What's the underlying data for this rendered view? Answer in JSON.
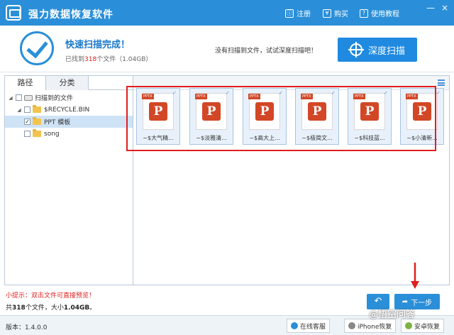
{
  "titlebar": {
    "title": "强力数据恢复软件",
    "register": "注册",
    "buy": "购买",
    "tutorial": "使用教程",
    "register_icon": "ⓘ",
    "buy_icon": "¥",
    "tutorial_icon": "?",
    "minimize": "—",
    "close": "×"
  },
  "header": {
    "status_title": "快速扫描完成！",
    "found_prefix": "已找到",
    "found_count": "318",
    "found_suffix": "个文件（1.04GB）",
    "hint": "没有扫描到文件，试试深度扫描吧！",
    "deep_scan_label": "深度扫描"
  },
  "tabs": {
    "path": "路径",
    "category": "分类"
  },
  "tree": [
    {
      "label": "扫描到的文件",
      "checked": false
    },
    {
      "label": "$RECYCLE.BIN",
      "checked": false
    },
    {
      "label": "PPT 模板",
      "checked": true
    },
    {
      "label": "song",
      "checked": false
    }
  ],
  "files": [
    {
      "name": "~$大气精..."
    },
    {
      "name": "~$淡雅清..."
    },
    {
      "name": "~$高大上..."
    },
    {
      "name": "~$极简文..."
    },
    {
      "name": "~$科技蓝..."
    },
    {
      "name": "~$小清新..."
    }
  ],
  "file_badge": "PPTX",
  "file_glyph": "P",
  "bottom": {
    "tip": "小提示：双击文件可直接预览！",
    "total_prefix": "共",
    "total_count": "318",
    "total_mid": "个文件，大小",
    "total_size": "1.04GB",
    "total_suffix": "。",
    "next_label": "下一步",
    "back_glyph": "↶",
    "next_glyph": "➦"
  },
  "footer": {
    "version": "版本：1.4.0.0",
    "online_support": "在线客服",
    "iphone_recovery": "iPhone恢复",
    "android_recovery": "安卓恢复"
  },
  "watermark": "@悟空问答",
  "colors": {
    "primary": "#2a8fd8",
    "highlight": "#e01e1e",
    "ppt": "#d24726"
  }
}
